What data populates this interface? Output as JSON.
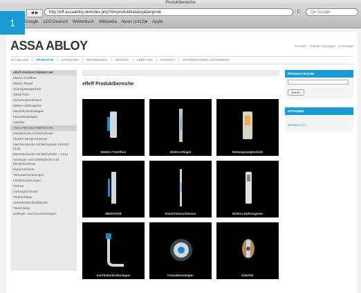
{
  "step_number": "1",
  "window_title": "Produktbereiche",
  "toolbar": {
    "nav_glyph": "◀ ▶",
    "url": "http://eff.assaabloy.de/index.php?id=produktkatalog&lang=de",
    "reload_glyph": "C",
    "search_placeholder": "Q▾ Google"
  },
  "bookmarks": [
    "Google",
    "LEO Deutsch",
    "Wörterbuch",
    "Wikipedia",
    "News (1412)▾",
    "Apple"
  ],
  "site": {
    "logo": "ASSA ABLOY",
    "top_links": [
      "Kontakt",
      "Change Language",
      "Homepage"
    ],
    "main_nav": [
      "AKTUELLES",
      "PRODUKTE",
      "LÖSUNGEN",
      "REFERENZEN",
      "SERVICE",
      "ÜBER UNS",
      "KONTAKT",
      "INFORMATIONEN ANFORDERN"
    ],
    "main_nav_active": 1
  },
  "sidebar": {
    "items": [
      {
        "label": "effeff PRODUKTBEREICHE",
        "type": "header"
      },
      {
        "label": "Elektro-Türöffner",
        "type": "item"
      },
      {
        "label": "Elektro-Riegel",
        "type": "item"
      },
      {
        "label": "Rettungswegtechnik",
        "type": "item"
      },
      {
        "label": "MEDIATOR",
        "type": "item"
      },
      {
        "label": "Sicherheitsschlösser",
        "type": "item"
      },
      {
        "label": "Elektro-Haftmagnete",
        "type": "item"
      },
      {
        "label": "Zutrittskontrollanlagen",
        "type": "item"
      },
      {
        "label": "Fassadenanlagen",
        "type": "item"
      },
      {
        "label": "Zubehör",
        "type": "item"
      },
      {
        "label": "ASSA PRODUKTBEREICHE",
        "type": "selected"
      },
      {
        "label": "Mechanische Schließzylinder",
        "type": "item"
      },
      {
        "label": "HUDEF Designschlösser",
        "type": "item"
      },
      {
        "label": "Mechatronische Schließzylinder VERSO CLIQ",
        "type": "item"
      },
      {
        "label": "Mechatronische Schließzylinder – CLIQ",
        "type": "item"
      },
      {
        "label": "Schlösser und Schließbleche inkl. Einsteckschloss",
        "type": "item"
      },
      {
        "label": "Motorschlösser",
        "type": "item"
      },
      {
        "label": "Türzusatzsicherungen",
        "type": "item"
      },
      {
        "label": "Fenstersicherungen",
        "type": "item"
      },
      {
        "label": "Tresore",
        "type": "item"
      },
      {
        "label": "Vorhangschlösser",
        "type": "item"
      },
      {
        "label": "Türbeschläge",
        "type": "item"
      },
      {
        "label": "Sicherheitsschließbleche",
        "type": "item"
      },
      {
        "label": "Türschließer",
        "type": "item"
      },
      {
        "label": "Software- und Servicelösungen",
        "type": "item"
      }
    ]
  },
  "content": {
    "title": "effeff Produktbereiche",
    "tiles": [
      {
        "caption": "Elektro-Türöffner",
        "icon": "door-opener-icon"
      },
      {
        "caption": "Elektro-Riegel",
        "icon": "electric-bolt-icon"
      },
      {
        "caption": "Rettungswegtechnik",
        "icon": "escape-route-icon"
      },
      {
        "caption": "MEDIATOR",
        "icon": "mediator-icon"
      },
      {
        "caption": "Sicherheitsschlösser",
        "icon": "security-lock-icon"
      },
      {
        "caption": "Elektro-Haftmagnete",
        "icon": "holding-magnet-icon"
      },
      {
        "caption": "Zutrittskontrollanlagen",
        "icon": "door-handle-icon"
      },
      {
        "caption": "Fassadenanlagen",
        "icon": "round-knob-icon"
      },
      {
        "caption": "Zubehör",
        "icon": "accessory-icon"
      }
    ]
  },
  "rightcol": {
    "search_head": "PRODUKTSUCHE",
    "search_button": "starten",
    "options_head": "OPTIONEN",
    "options_link": "Merkliste (0) »"
  },
  "colors": {
    "accent": "#1a9bd1",
    "tile_bg": "#000000"
  }
}
